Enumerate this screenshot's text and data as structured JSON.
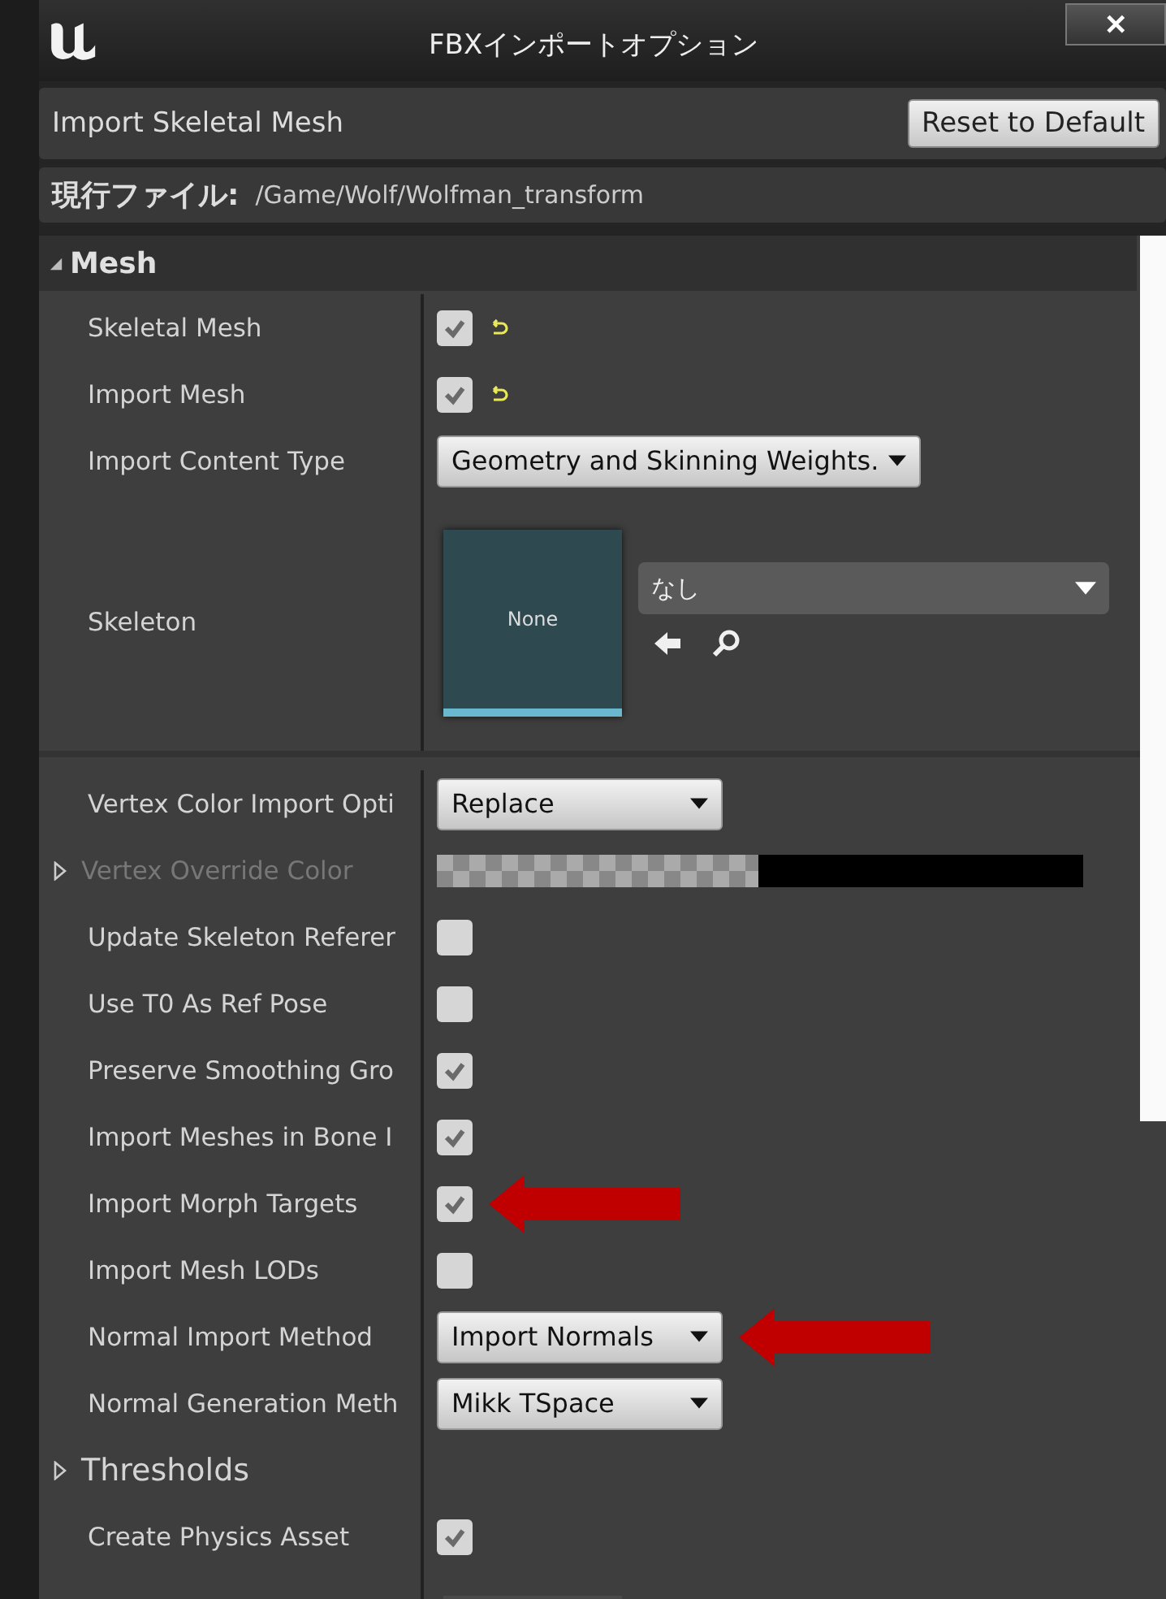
{
  "window": {
    "title": "FBXインポートオプション",
    "close": "✕"
  },
  "header": {
    "title": "Import Skeletal Mesh",
    "reset_button": "Reset to Default"
  },
  "current_file": {
    "label": "現行ファイル:",
    "path": "/Game/Wolf/Wolfman_transform"
  },
  "section": {
    "title": "Mesh",
    "expanded": true
  },
  "rows": [
    {
      "kind": "checkbox",
      "label": "Skeletal Mesh",
      "checked": true,
      "modified": true
    },
    {
      "kind": "checkbox",
      "label": "Import Mesh",
      "checked": true,
      "modified": true
    },
    {
      "kind": "dropdown",
      "label": "Import Content Type",
      "value": "Geometry and Skinning Weights."
    },
    {
      "kind": "asset",
      "label": "Skeleton",
      "thumbnail": "None",
      "value": "なし"
    },
    {
      "kind": "dropdown",
      "label": "Vertex Color Import Opti",
      "value": "Replace"
    },
    {
      "kind": "color",
      "label": "Vertex Override Color",
      "disabled": true,
      "expanded": false
    },
    {
      "kind": "checkbox",
      "label": "Update Skeleton Referer",
      "checked": false
    },
    {
      "kind": "checkbox",
      "label": "Use T0 As Ref Pose",
      "checked": false
    },
    {
      "kind": "checkbox",
      "label": "Preserve Smoothing Gro",
      "checked": true
    },
    {
      "kind": "checkbox",
      "label": "Import Meshes in Bone I",
      "checked": true
    },
    {
      "kind": "checkbox",
      "label": "Import Morph Targets",
      "checked": true,
      "annotated": true
    },
    {
      "kind": "checkbox",
      "label": "Import Mesh LODs",
      "checked": false
    },
    {
      "kind": "dropdown",
      "label": "Normal Import Method",
      "value": "Import Normals",
      "annotated": true
    },
    {
      "kind": "dropdown",
      "label": "Normal Generation Meth",
      "value": "Mikk TSpace"
    },
    {
      "kind": "group",
      "label": "Thresholds",
      "expanded": false
    },
    {
      "kind": "checkbox",
      "label": "Create Physics Asset",
      "checked": true
    },
    {
      "kind": "asset_cut"
    }
  ]
}
